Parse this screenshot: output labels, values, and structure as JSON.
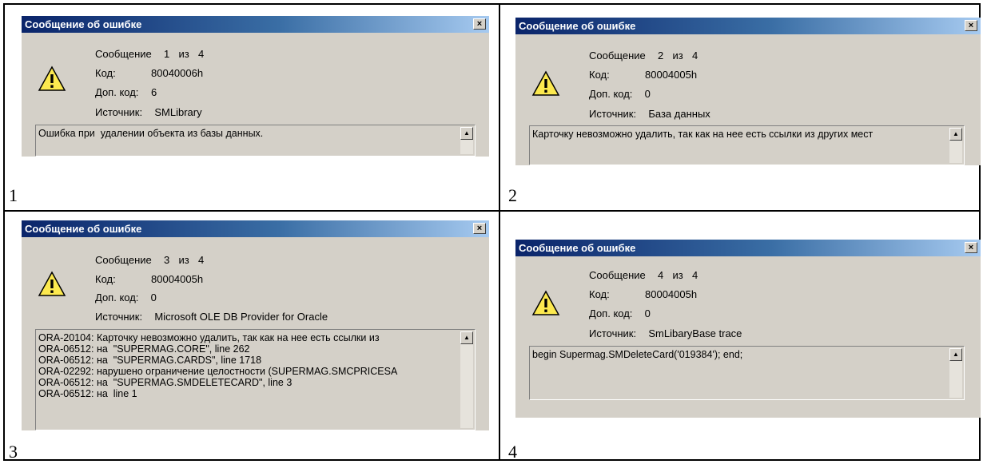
{
  "panels": [
    {
      "number": "1",
      "title": "Сообщение об ошибке",
      "close": "×",
      "message_label": "Сообщение",
      "message_index": "1",
      "message_of": "из",
      "message_total": "4",
      "code_label": "Код:",
      "code": "80040006h",
      "extra_label": "Доп. код:",
      "extra": "6",
      "source_label": "Источник:",
      "source": "SMLibrary",
      "text": "Ошибка при  удалении объекта из базы данных."
    },
    {
      "number": "2",
      "title": "Сообщение об ошибке",
      "close": "×",
      "message_label": "Сообщение",
      "message_index": "2",
      "message_of": "из",
      "message_total": "4",
      "code_label": "Код:",
      "code": "80004005h",
      "extra_label": "Доп. код:",
      "extra": "0",
      "source_label": "Источник:",
      "source": "База данных",
      "text": "Карточку невозможно удалить, так как на нее есть ссылки из других мест"
    },
    {
      "number": "3",
      "title": "Сообщение об ошибке",
      "close": "×",
      "message_label": "Сообщение",
      "message_index": "3",
      "message_of": "из",
      "message_total": "4",
      "code_label": "Код:",
      "code": "80004005h",
      "extra_label": "Доп. код:",
      "extra": "0",
      "source_label": "Источник:",
      "source": "Microsoft OLE DB Provider for Oracle",
      "text": "ORA-20104: Карточку невозможно удалить, так как на нее есть ссылки из\nORA-06512: на  \"SUPERMAG.CORE\", line 262\nORA-06512: на  \"SUPERMAG.CARDS\", line 1718\nORA-02292: нарушено ограничение целостности (SUPERMAG.SMCPRICESA\nORA-06512: на  \"SUPERMAG.SMDELETECARD\", line 3\nORA-06512: на  line 1"
    },
    {
      "number": "4",
      "title": "Сообщение об ошибке",
      "close": "×",
      "message_label": "Сообщение",
      "message_index": "4",
      "message_of": "из",
      "message_total": "4",
      "code_label": "Код:",
      "code": "80004005h",
      "extra_label": "Доп. код:",
      "extra": "0",
      "source_label": "Источник:",
      "source": "SmLibaryBase trace",
      "text": "begin Supermag.SMDeleteCard('019384'); end;"
    }
  ],
  "icons": {
    "warning": "warning-icon",
    "close": "close-icon",
    "scroll_up": "scroll-up-arrow-icon"
  },
  "colors": {
    "titlebar_start": "#0a246a",
    "titlebar_end": "#a6caf0",
    "dialog_bg": "#d4d0c8"
  }
}
